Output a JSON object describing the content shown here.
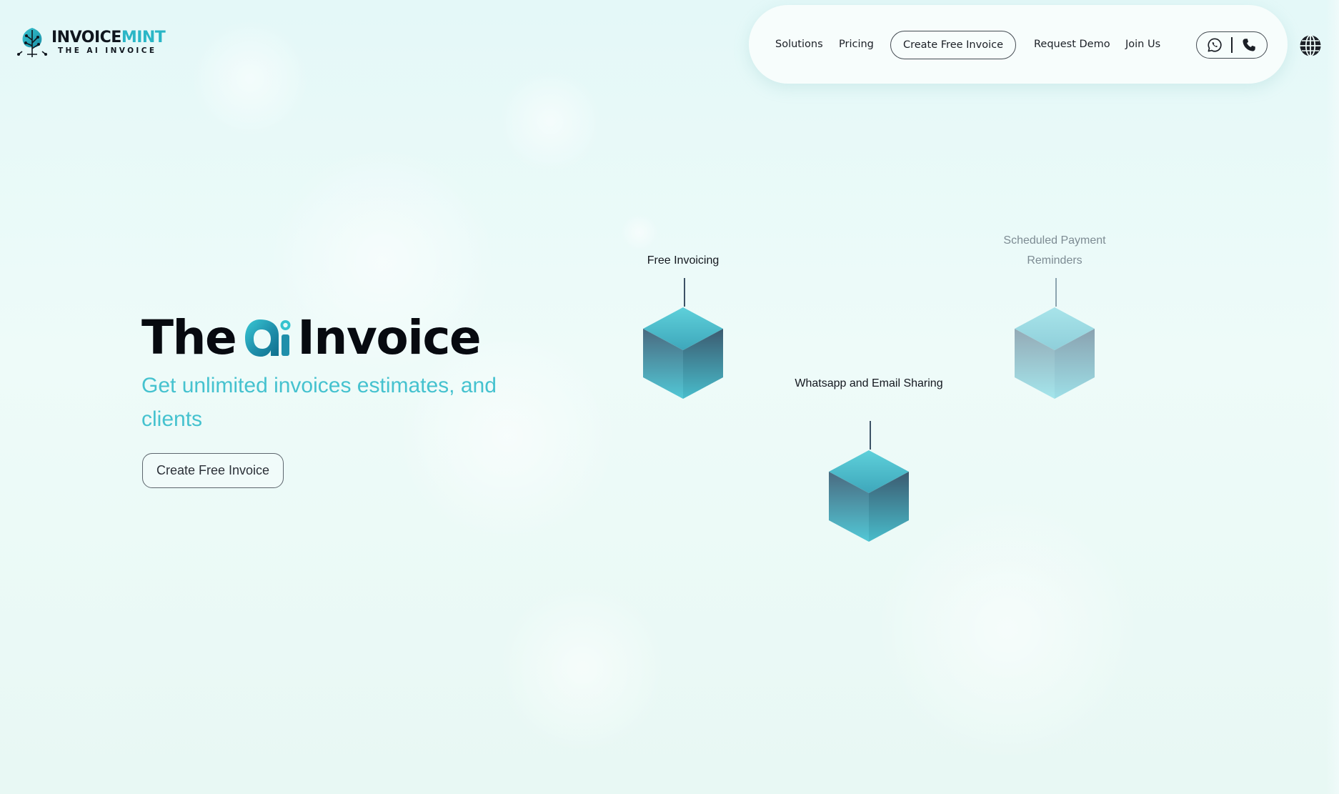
{
  "brand": {
    "name_part1": "INVOICE",
    "name_part2": "MINT",
    "tagline": "THE AI INVOICE"
  },
  "nav": {
    "items": [
      {
        "label": "Solutions"
      },
      {
        "label": "Pricing"
      },
      {
        "label": "Create Free Invoice"
      },
      {
        "label": "Request Demo"
      },
      {
        "label": "Join Us"
      }
    ],
    "contact_icons": [
      "whatsapp-icon",
      "phone-icon"
    ],
    "language_icon": "globe-icon"
  },
  "hero": {
    "title_before": "The",
    "title_logo_icon": "ai-glyph",
    "title_after": "Invoice",
    "subtitle": "Get unlimited invoices estimates, and clients",
    "cta_label": "Create Free Invoice"
  },
  "features": [
    {
      "label": "Free Invoicing",
      "state": "active"
    },
    {
      "label": "Whatsapp and Email Sharing",
      "state": "active"
    },
    {
      "label": "Scheduled Payment Reminders",
      "state": "faded"
    }
  ],
  "colors": {
    "accent": "#2ab6c6",
    "subtitle": "#45c2cf",
    "text_dark": "#070a10",
    "background": "#e4f8f8"
  }
}
